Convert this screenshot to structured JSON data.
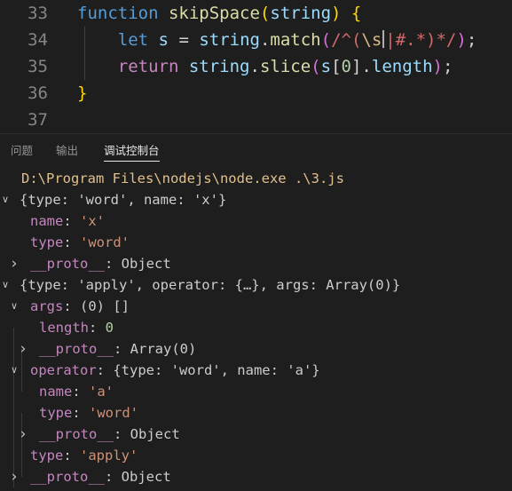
{
  "editor": {
    "lines": [
      {
        "num": "33",
        "tokens": [
          {
            "t": "function",
            "c": "kw"
          },
          {
            "t": " ",
            "c": "pun"
          },
          {
            "t": "skipSpace",
            "c": "fn"
          },
          {
            "t": "(",
            "c": "brk1"
          },
          {
            "t": "string",
            "c": "var"
          },
          {
            "t": ")",
            "c": "brk1"
          },
          {
            "t": " ",
            "c": "pun"
          },
          {
            "t": "{",
            "c": "brk1"
          }
        ]
      },
      {
        "num": "34",
        "tokens": [
          {
            "t": "    ",
            "c": "pun"
          },
          {
            "t": "let",
            "c": "kw"
          },
          {
            "t": " ",
            "c": "pun"
          },
          {
            "t": "s",
            "c": "var"
          },
          {
            "t": " = ",
            "c": "pun"
          },
          {
            "t": "string",
            "c": "var"
          },
          {
            "t": ".",
            "c": "pun"
          },
          {
            "t": "match",
            "c": "fn"
          },
          {
            "t": "(",
            "c": "brk2"
          },
          {
            "t": "/^(",
            "c": "re"
          },
          {
            "t": "\\s",
            "c": "re-esc"
          },
          {
            "t": "|#.*)*/",
            "c": "re"
          },
          {
            "t": ")",
            "c": "brk2"
          },
          {
            "t": ";",
            "c": "pun"
          }
        ]
      },
      {
        "num": "35",
        "tokens": [
          {
            "t": "    ",
            "c": "pun"
          },
          {
            "t": "return",
            "c": "kw2"
          },
          {
            "t": " ",
            "c": "pun"
          },
          {
            "t": "string",
            "c": "var"
          },
          {
            "t": ".",
            "c": "pun"
          },
          {
            "t": "slice",
            "c": "fn"
          },
          {
            "t": "(",
            "c": "brk2"
          },
          {
            "t": "s",
            "c": "var"
          },
          {
            "t": "[",
            "c": "pun"
          },
          {
            "t": "0",
            "c": "num"
          },
          {
            "t": "]",
            "c": "pun"
          },
          {
            "t": ".",
            "c": "pun"
          },
          {
            "t": "length",
            "c": "var"
          },
          {
            "t": ")",
            "c": "brk2"
          },
          {
            "t": ";",
            "c": "pun"
          }
        ]
      },
      {
        "num": "36",
        "tokens": [
          {
            "t": "}",
            "c": "brk1"
          }
        ]
      },
      {
        "num": "37",
        "tokens": []
      }
    ]
  },
  "panel": {
    "tabs": [
      {
        "label": "问题",
        "active": false
      },
      {
        "label": "输出",
        "active": false
      },
      {
        "label": "调试控制台",
        "active": true
      }
    ]
  },
  "console": {
    "lines": [
      {
        "indent": 0,
        "chev": "",
        "tokens": [
          {
            "t": "D:\\Program Files\\nodejs\\node.exe .\\3.js",
            "c": "path"
          }
        ]
      },
      {
        "indent": 0,
        "chev": "down",
        "tokens": [
          {
            "t": "{type: 'word', name: 'x'}",
            "c": "obj"
          }
        ]
      },
      {
        "indent": 1,
        "chev": "",
        "tokens": [
          {
            "t": "name",
            "c": "key"
          },
          {
            "t": ": ",
            "c": "gray"
          },
          {
            "t": "'x'",
            "c": "str"
          }
        ]
      },
      {
        "indent": 1,
        "chev": "",
        "tokens": [
          {
            "t": "type",
            "c": "key"
          },
          {
            "t": ": ",
            "c": "gray"
          },
          {
            "t": "'word'",
            "c": "str"
          }
        ]
      },
      {
        "indent": 1,
        "chev": "right",
        "tokens": [
          {
            "t": "__proto__",
            "c": "key"
          },
          {
            "t": ": ",
            "c": "gray"
          },
          {
            "t": "Object",
            "c": "gray"
          }
        ]
      },
      {
        "indent": 0,
        "chev": "down",
        "tokens": [
          {
            "t": "{type: 'apply', operator: {…}, args: Array(0)}",
            "c": "obj"
          }
        ]
      },
      {
        "indent": 1,
        "chev": "down",
        "tokens": [
          {
            "t": "args",
            "c": "key"
          },
          {
            "t": ": (0) []",
            "c": "gray"
          }
        ]
      },
      {
        "indent": 2,
        "chev": "",
        "tokens": [
          {
            "t": "length",
            "c": "key"
          },
          {
            "t": ": ",
            "c": "gray"
          },
          {
            "t": "0",
            "c": "num"
          }
        ]
      },
      {
        "indent": 2,
        "chev": "right",
        "tokens": [
          {
            "t": "__proto__",
            "c": "key"
          },
          {
            "t": ": ",
            "c": "gray"
          },
          {
            "t": "Array(0)",
            "c": "gray"
          }
        ]
      },
      {
        "indent": 1,
        "chev": "down",
        "tokens": [
          {
            "t": "operator",
            "c": "key"
          },
          {
            "t": ": {type: 'word', name: 'a'}",
            "c": "gray"
          }
        ]
      },
      {
        "indent": 2,
        "chev": "",
        "tokens": [
          {
            "t": "name",
            "c": "key"
          },
          {
            "t": ": ",
            "c": "gray"
          },
          {
            "t": "'a'",
            "c": "str"
          }
        ]
      },
      {
        "indent": 2,
        "chev": "",
        "tokens": [
          {
            "t": "type",
            "c": "key"
          },
          {
            "t": ": ",
            "c": "gray"
          },
          {
            "t": "'word'",
            "c": "str"
          }
        ]
      },
      {
        "indent": 2,
        "chev": "right",
        "tokens": [
          {
            "t": "__proto__",
            "c": "key"
          },
          {
            "t": ": ",
            "c": "gray"
          },
          {
            "t": "Object",
            "c": "gray"
          }
        ]
      },
      {
        "indent": 1,
        "chev": "",
        "tokens": [
          {
            "t": "type",
            "c": "key"
          },
          {
            "t": ": ",
            "c": "gray"
          },
          {
            "t": "'apply'",
            "c": "str"
          }
        ]
      },
      {
        "indent": 1,
        "chev": "right",
        "tokens": [
          {
            "t": "__proto__",
            "c": "key"
          },
          {
            "t": ": ",
            "c": "gray"
          },
          {
            "t": "Object",
            "c": "gray"
          }
        ]
      }
    ]
  }
}
